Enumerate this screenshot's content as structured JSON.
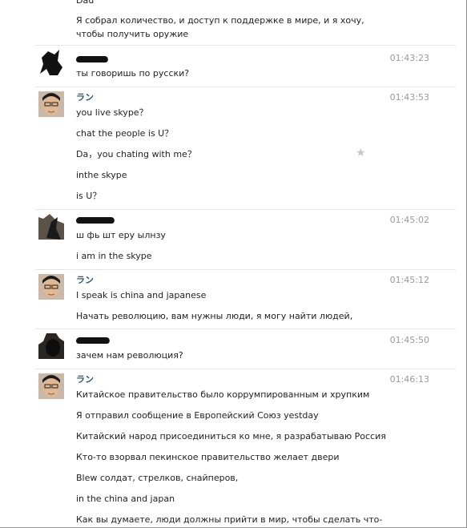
{
  "chat": {
    "top_partial_name": "Dau",
    "top_message": [
      "Я собрал количество, и доступ к поддержке в мире, и я хочу,",
      "чтобы получить оружие"
    ],
    "name_ran": "ラン",
    "blocks": [
      {
        "time": "01:43:23",
        "messages": [
          "ты говоришь по русски?"
        ]
      },
      {
        "time": "01:43:53",
        "messages": [
          "you live skype？",
          "chat the people is U？",
          "Da，you chating with me？",
          "inthe skype",
          "is U？"
        ]
      },
      {
        "time": "01:45:02",
        "messages": [
          "ш фь шт еру ылнзу",
          "i am in the skype"
        ]
      },
      {
        "time": "01:45:12",
        "messages": [
          "I speak is china and japanese",
          "Начать революцию, вам нужны люди, я могу найти людей,"
        ]
      },
      {
        "time": "01:45:50",
        "messages": [
          "зачем нам революция?"
        ]
      },
      {
        "time": "01:46:13",
        "messages": [
          "Китайское правительство было коррумпированным и хрупким",
          "Я отправил сообщение в Европейский Союз yestday",
          "Китайский народ присоединиться ко мне, я разрабатываю Россия",
          "Кто-то взорвал пекинское правительство желает двери",
          "Blew солдат, стрелков, снайперов,",
          "in the china and japan",
          "Как вы думаете, люди должны прийти в мир, чтобы сделать что-"
        ]
      }
    ]
  },
  "icons": {
    "favorite": "star-icon"
  },
  "colors": {
    "name_link": "#2b587a",
    "timestamp": "#9a9a9a",
    "separator": "#e6e6e6",
    "star": "#c8c8c8"
  }
}
